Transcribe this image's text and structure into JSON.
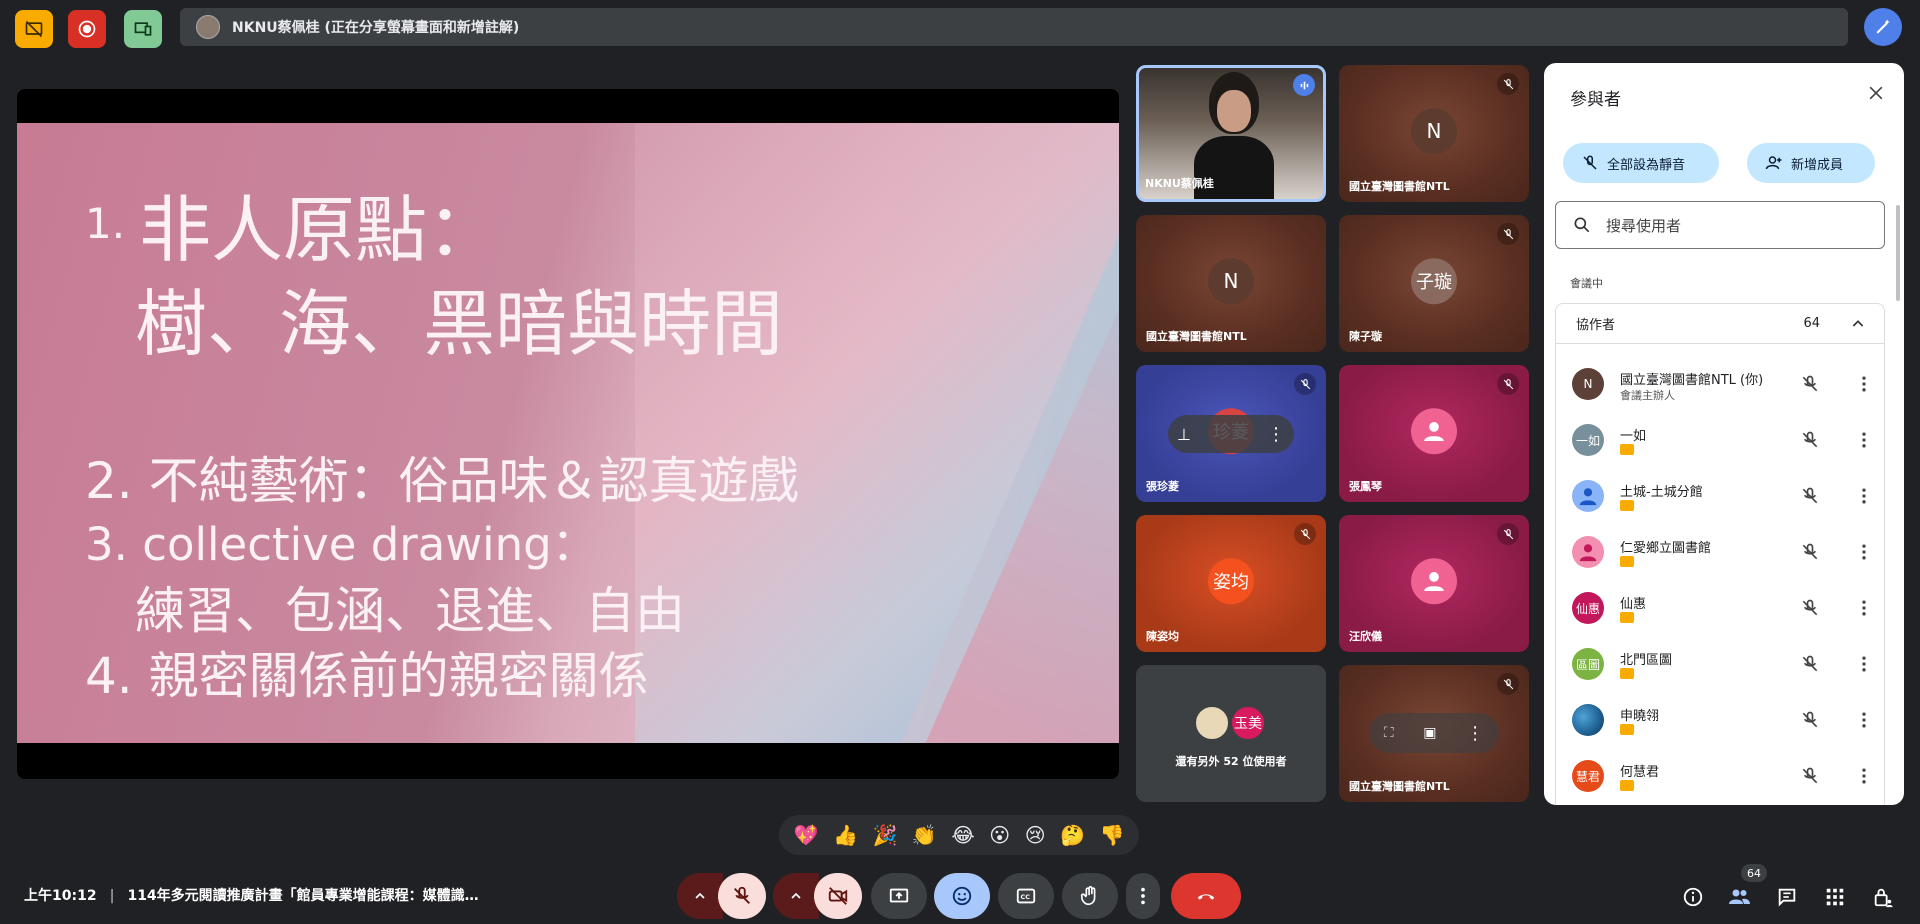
{
  "topbar": {
    "share_banner": "NKNU蔡佩桂 (正在分享螢幕畫面和新增註解)",
    "colors": {
      "stop_present": "#f9ab00",
      "record": "#d93025",
      "companion": "#81c995",
      "wand": "#4f7fe8"
    }
  },
  "slide": {
    "item1_num": "1.",
    "item1_line1": "非人原點：",
    "item1_line2": "樹、海、黑暗與時間",
    "item2": "2. 不純藝術：俗品味＆認真遊戲",
    "item3_line1": "3. collective drawing：",
    "item3_line2": "練習、包涵、退進、自由",
    "item4": "4. 親密關係前的親密關係"
  },
  "tiles": [
    {
      "name": "NKNU蔡佩桂",
      "kind": "video",
      "speaking": true
    },
    {
      "name": "國立臺灣圖書館NTL",
      "avatar": "N",
      "muted": true
    },
    {
      "name": "國立臺灣圖書館NTL",
      "avatar": "N",
      "muted": false
    },
    {
      "name": "陳子璇",
      "avatar": "子璇",
      "muted": true
    },
    {
      "name": "張珍菱",
      "avatar": "珍菱",
      "muted": true,
      "hover": true
    },
    {
      "name": "張鳳琴",
      "avatar": "person",
      "muted": true
    },
    {
      "name": "陳姿均",
      "avatar": "姿均",
      "muted": true
    },
    {
      "name": "汪欣儀",
      "avatar": "person",
      "muted": true
    },
    {
      "name": "還有另外 52 位使用者",
      "avatar2": "玉美"
    },
    {
      "name": "國立臺灣圖書館NTL",
      "muted": true,
      "hover": true
    }
  ],
  "panel": {
    "title": "參與者",
    "mute_all": "全部設為靜音",
    "add_people": "新增成員",
    "search_placeholder": "搜尋使用者",
    "section": "會議中",
    "group_title": "協作者",
    "group_count": "64",
    "people": [
      {
        "name": "國立臺灣圖書館NTL (你)",
        "sub": "會議主辦人",
        "avatar": "N",
        "color": "#5d4037"
      },
      {
        "name": "一如",
        "avatar": "一如",
        "color": "#78909c"
      },
      {
        "name": "土城-土城分館",
        "avatar": "person",
        "color": "#4285f4"
      },
      {
        "name": "仁愛鄉立圖書館",
        "avatar": "person",
        "color": "#e8467c"
      },
      {
        "name": "仙惠",
        "avatar": "仙惠",
        "color": "#c2185b"
      },
      {
        "name": "北門區圖",
        "avatar": "區圖",
        "color": "#7cb342"
      },
      {
        "name": "申曉翎",
        "avatar": "photo",
        "color": "#1e6091"
      },
      {
        "name": "何慧君",
        "avatar": "慧君",
        "color": "#e64a19"
      }
    ]
  },
  "reactions": [
    "💖",
    "👍",
    "🎉",
    "👏",
    "😂",
    "😮",
    "😢",
    "🤔",
    "👎"
  ],
  "bottom": {
    "time": "上午10:12",
    "meeting_title": "114年多元閱讀推廣計畫「館員專業增能課程：媒體識…",
    "people_count": "64"
  }
}
